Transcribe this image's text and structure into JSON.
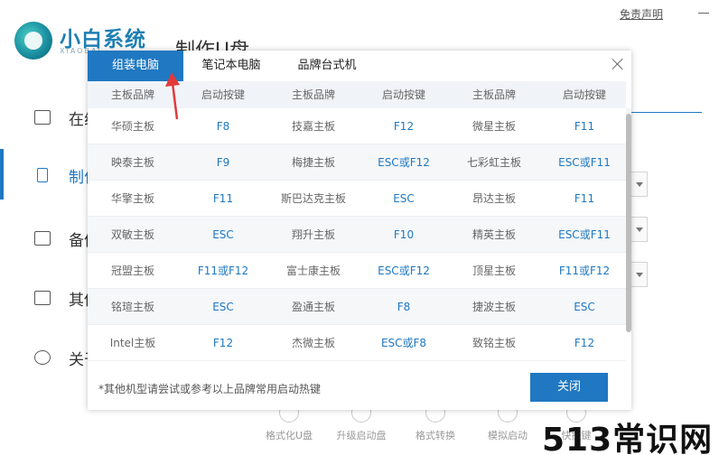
{
  "app": {
    "logo_title": "小白系统",
    "logo_sub": "XIAOBAI",
    "page_heading": "制作U盘",
    "disclaimer": "免责声明",
    "sidebar": [
      {
        "label": "在线",
        "icon": "monitor-icon"
      },
      {
        "label": "制作",
        "icon": "usb-icon"
      },
      {
        "label": "备份",
        "icon": "grid-icon"
      },
      {
        "label": "其他",
        "icon": "toolbox-icon"
      },
      {
        "label": "关于",
        "icon": "info-icon"
      }
    ],
    "bottom_tools": [
      {
        "label": "格式化U盘",
        "icon": "format-icon"
      },
      {
        "label": "升级启动盘",
        "icon": "upgrade-icon"
      },
      {
        "label": "格式转换",
        "icon": "convert-icon"
      },
      {
        "label": "模拟启动",
        "icon": "simulate-icon"
      },
      {
        "label": "快捷键",
        "icon": "hotkey-icon"
      }
    ]
  },
  "watermark": "513常识网",
  "modal": {
    "tabs": [
      {
        "label": "组装电脑",
        "active": true
      },
      {
        "label": "笔记本电脑",
        "active": false
      },
      {
        "label": "品牌台式机",
        "active": false
      }
    ],
    "headers": [
      "主板品牌",
      "启动按键",
      "主板品牌",
      "启动按键",
      "主板品牌",
      "启动按键"
    ],
    "rows": [
      [
        "华硕主板",
        "F8",
        "技嘉主板",
        "F12",
        "微星主板",
        "F11"
      ],
      [
        "映泰主板",
        "F9",
        "梅捷主板",
        "ESC或F12",
        "七彩虹主板",
        "ESC或F11"
      ],
      [
        "华擎主板",
        "F11",
        "斯巴达克主板",
        "ESC",
        "昂达主板",
        "F11"
      ],
      [
        "双敏主板",
        "ESC",
        "翔升主板",
        "F10",
        "精英主板",
        "ESC或F11"
      ],
      [
        "冠盟主板",
        "F11或F12",
        "富士康主板",
        "ESC或F12",
        "顶星主板",
        "F11或F12"
      ],
      [
        "铭瑄主板",
        "ESC",
        "盈通主板",
        "F8",
        "捷波主板",
        "ESC"
      ],
      [
        "Intel主板",
        "F12",
        "杰微主板",
        "ESC或F8",
        "致铭主板",
        "F12"
      ]
    ],
    "footer_note": "*其他机型请尝试或参考以上品牌常用启动热键",
    "close_label": "关闭",
    "accent": "#1f78c1"
  }
}
